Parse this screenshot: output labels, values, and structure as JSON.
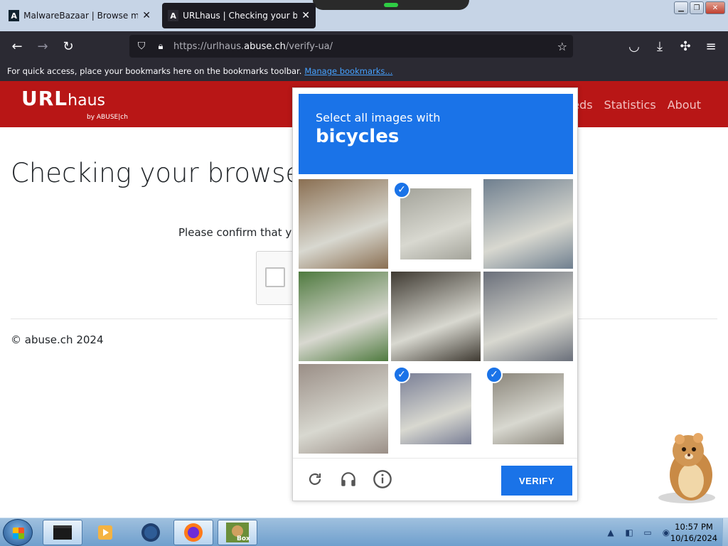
{
  "browser": {
    "tabs": [
      {
        "label": "MalwareBazaar | Browse malwa",
        "favicon": "A"
      },
      {
        "label": "URLhaus | Checking your brow",
        "favicon": "A"
      }
    ],
    "url": {
      "scheme": "https://urlhaus.",
      "host": "abuse.ch",
      "path": "/verify-ua/"
    },
    "bookmarks_text": "For quick access, place your bookmarks here on the bookmarks toolbar.",
    "bookmarks_link": "Manage bookmarks..."
  },
  "site": {
    "logo_main": "URL",
    "logo_suffix": "haus",
    "logo_by": "by ABUSE|ch",
    "nav": [
      "Feeds",
      "Statistics",
      "About"
    ],
    "heading": "Checking your browser",
    "confirm_text": "Please confirm that you",
    "footer": "© abuse.ch 2024"
  },
  "challenge": {
    "prompt": "Select all images with",
    "target": "bicycles",
    "tiles": [
      {
        "desc": "porch",
        "selected": false,
        "color": "#8a6f52"
      },
      {
        "desc": "cyclist-road",
        "selected": true,
        "color": "#a3a39a"
      },
      {
        "desc": "street-car",
        "selected": false,
        "color": "#6f7f8f"
      },
      {
        "desc": "hillside",
        "selected": false,
        "color": "#4f7a3f"
      },
      {
        "desc": "bins",
        "selected": false,
        "color": "#3f3a32"
      },
      {
        "desc": "tractor",
        "selected": false,
        "color": "#6a6f7a"
      },
      {
        "desc": "orange-bike",
        "selected": false,
        "color": "#9a8e86"
      },
      {
        "desc": "cyclists-crossing",
        "selected": true,
        "color": "#7a7f96"
      },
      {
        "desc": "parked-bikes",
        "selected": true,
        "color": "#8a857a"
      }
    ],
    "verify_label": "VERIFY",
    "icons": [
      "reload-icon",
      "headphones-icon",
      "info-icon"
    ]
  },
  "taskbar": {
    "time": "10:57 PM",
    "date": "10/16/2024",
    "task5_label": "Box"
  }
}
